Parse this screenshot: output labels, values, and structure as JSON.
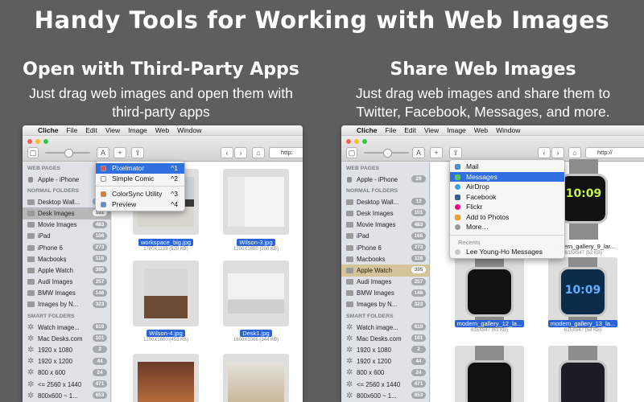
{
  "headline": "Handy Tools for Working with Web Images",
  "left_panel": {
    "heading": "Open with Third-Party Apps",
    "subtitle_line1": "Just drag web images and open them with",
    "subtitle_line2": "third-party apps"
  },
  "right_panel": {
    "heading": "Share Web Images",
    "subtitle_line1": "Just drag web images and share them to",
    "subtitle_line2": "Twitter, Facebook, Messages, and more."
  },
  "menubar": {
    "apple": "",
    "app": "Cliche",
    "items": [
      "File",
      "Edit",
      "View",
      "Image",
      "Web",
      "Window"
    ]
  },
  "toolbar": {
    "add": "+",
    "share": "⇪",
    "back": "‹",
    "forward": "›",
    "home": "⌂",
    "text_tool": "A",
    "url_text_left": "http:",
    "url_text_right": "http://"
  },
  "sidebar_left": {
    "web_pages_header": "WEB PAGES",
    "web_pages": [
      {
        "label": "Apple - iPhone",
        "count": ""
      }
    ],
    "normal_header": "NORMAL FOLDERS",
    "normal": [
      {
        "label": "Desktop Wall...",
        "count": "12"
      },
      {
        "label": "Desk Images",
        "count": "101"
      },
      {
        "label": "Movie Images",
        "count": "483"
      },
      {
        "label": "iPad",
        "count": "166"
      },
      {
        "label": "iPhone 6",
        "count": "273"
      },
      {
        "label": "Macbooks",
        "count": "116"
      },
      {
        "label": "Apple Watch",
        "count": "395"
      },
      {
        "label": "Audi Images",
        "count": "257"
      },
      {
        "label": "BMW Images",
        "count": "146"
      },
      {
        "label": "Images by N...",
        "count": "323"
      }
    ],
    "smart_header": "SMART FOLDERS",
    "smart": [
      {
        "label": "Watch image...",
        "count": "619"
      },
      {
        "label": "Mac Desks.com",
        "count": "101"
      },
      {
        "label": "1920 x 1080",
        "count": "2"
      },
      {
        "label": "1920 x 1200",
        "count": "44"
      },
      {
        "label": "800 x 600",
        "count": "24"
      },
      {
        "label": "<= 2560 x 1440",
        "count": "471"
      },
      {
        "label": "800x600 ~ 1...",
        "count": "653"
      }
    ]
  },
  "sidebar_right": {
    "web_pages_header": "WEB PAGES",
    "web_pages": [
      {
        "label": "Apple - iPhone",
        "count": "29"
      }
    ],
    "normal_header": "NORMAL FOLDERS",
    "normal": [
      {
        "label": "Desktop Wall...",
        "count": "12"
      },
      {
        "label": "Desk Images",
        "count": "101"
      },
      {
        "label": "Movie Images",
        "count": "483"
      },
      {
        "label": "iPad",
        "count": "166"
      },
      {
        "label": "iPhone 6",
        "count": "273"
      },
      {
        "label": "Macbooks",
        "count": "116"
      },
      {
        "label": "Apple Watch",
        "count": "395"
      },
      {
        "label": "Audi Images",
        "count": "257"
      },
      {
        "label": "BMW Images",
        "count": "146"
      },
      {
        "label": "Images by N...",
        "count": "323"
      }
    ],
    "smart_header": "SMART FOLDERS",
    "smart": [
      {
        "label": "Watch image...",
        "count": "619"
      },
      {
        "label": "Mac Desks.com",
        "count": "101"
      },
      {
        "label": "1920 x 1080",
        "count": "2"
      },
      {
        "label": "1920 x 1200",
        "count": "44"
      },
      {
        "label": "800 x 600",
        "count": "24"
      },
      {
        "label": "<= 2560 x 1440",
        "count": "471"
      },
      {
        "label": "800x600 ~ 1...",
        "count": "853"
      }
    ]
  },
  "thumbs_left": [
    {
      "name": "workspace_big.jpg",
      "dims": "1700X1133 (520 KB)"
    },
    {
      "name": "Wilson-3.jpg",
      "dims": "1200X1600 (208 KB)"
    },
    {
      "name": "Wilson-4.jpg",
      "dims": "1200X1600 (453 KB)"
    },
    {
      "name": "Desk1.jpg",
      "dims": "1600X1066 (344 KB)"
    }
  ],
  "thumbs_right": [
    {
      "name": "modern_gallery_9_lar...",
      "dims": "615X547 (52 KB)",
      "time": "10:09"
    },
    {
      "name": "modern_gallery_12_la...",
      "dims": "615X547 (63 KB)",
      "time": ""
    },
    {
      "name": "modern_gallery_13_la...",
      "dims": "615X547 (54 KB)",
      "time": "10:09"
    }
  ],
  "open_menu": {
    "items": [
      {
        "label": "Pixelmator",
        "shortcut": "^1",
        "color": "#d9534f"
      },
      {
        "label": "Simple Comic",
        "shortcut": "^2",
        "color": "#f5f5f5"
      },
      {
        "label": "ColorSync Utility",
        "shortcut": "^3",
        "color": "#e07a2f"
      },
      {
        "label": "Preview",
        "shortcut": "^4",
        "color": "#5a8fd6"
      }
    ]
  },
  "share_menu": {
    "items": [
      {
        "label": "Mail",
        "color": "#4a90d9"
      },
      {
        "label": "Messages",
        "color": "#5cc35c"
      },
      {
        "label": "AirDrop",
        "color": "#3aa0e8"
      },
      {
        "label": "Facebook",
        "color": "#3b5998"
      },
      {
        "label": "Flickr",
        "color": "#ff0084"
      },
      {
        "label": "Add to Photos",
        "color": "#f0a030"
      },
      {
        "label": "More…",
        "color": "#999999"
      }
    ],
    "recents_header": "Recents",
    "recent": "Lee Young-Ho Messages"
  }
}
